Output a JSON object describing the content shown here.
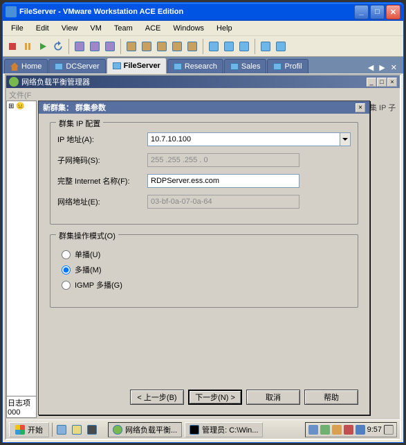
{
  "outer": {
    "title": "FileServer - VMware Workstation ACE Edition",
    "menus": [
      "File",
      "Edit",
      "View",
      "VM",
      "Team",
      "ACE",
      "Windows",
      "Help"
    ]
  },
  "vmtabs": {
    "home": "Home",
    "items": [
      "DCServer",
      "FileServer",
      "Research",
      "Sales",
      "Profil"
    ],
    "active_index": 1
  },
  "inner": {
    "title": "网络负载平衡管理器",
    "menu_stub": "文件(F",
    "right_stub": "集 IP 子",
    "log_label": "日志项",
    "log_val": "000"
  },
  "dialog": {
    "title": "新群集：  群集参数",
    "group_ip": {
      "legend": "群集 IP 配置",
      "ip_label": "IP 地址(A):",
      "ip_value": "10.7.10.100",
      "subnet_label": "子网掩码(S):",
      "subnet_value": "255 .255 .255 . 0",
      "fqdn_label": "完整 Internet 名称(F):",
      "fqdn_value": "RDPServer.ess.com",
      "mac_label": "网络地址(E):",
      "mac_value": "03-bf-0a-07-0a-64"
    },
    "group_mode": {
      "legend": "群集操作模式(O)",
      "unicast": "单播(U)",
      "multicast": "多播(M)",
      "igmp": "IGMP 多播(G)",
      "selected": "multicast"
    },
    "buttons": {
      "back": "< 上一步(B)",
      "next": "下一步(N) >",
      "cancel": "取消",
      "help": "帮助"
    }
  },
  "taskbar": {
    "start": "开始",
    "task1": "网络负载平衡...",
    "task2": "管理员: C:\\Win...",
    "clock": "9:57"
  }
}
